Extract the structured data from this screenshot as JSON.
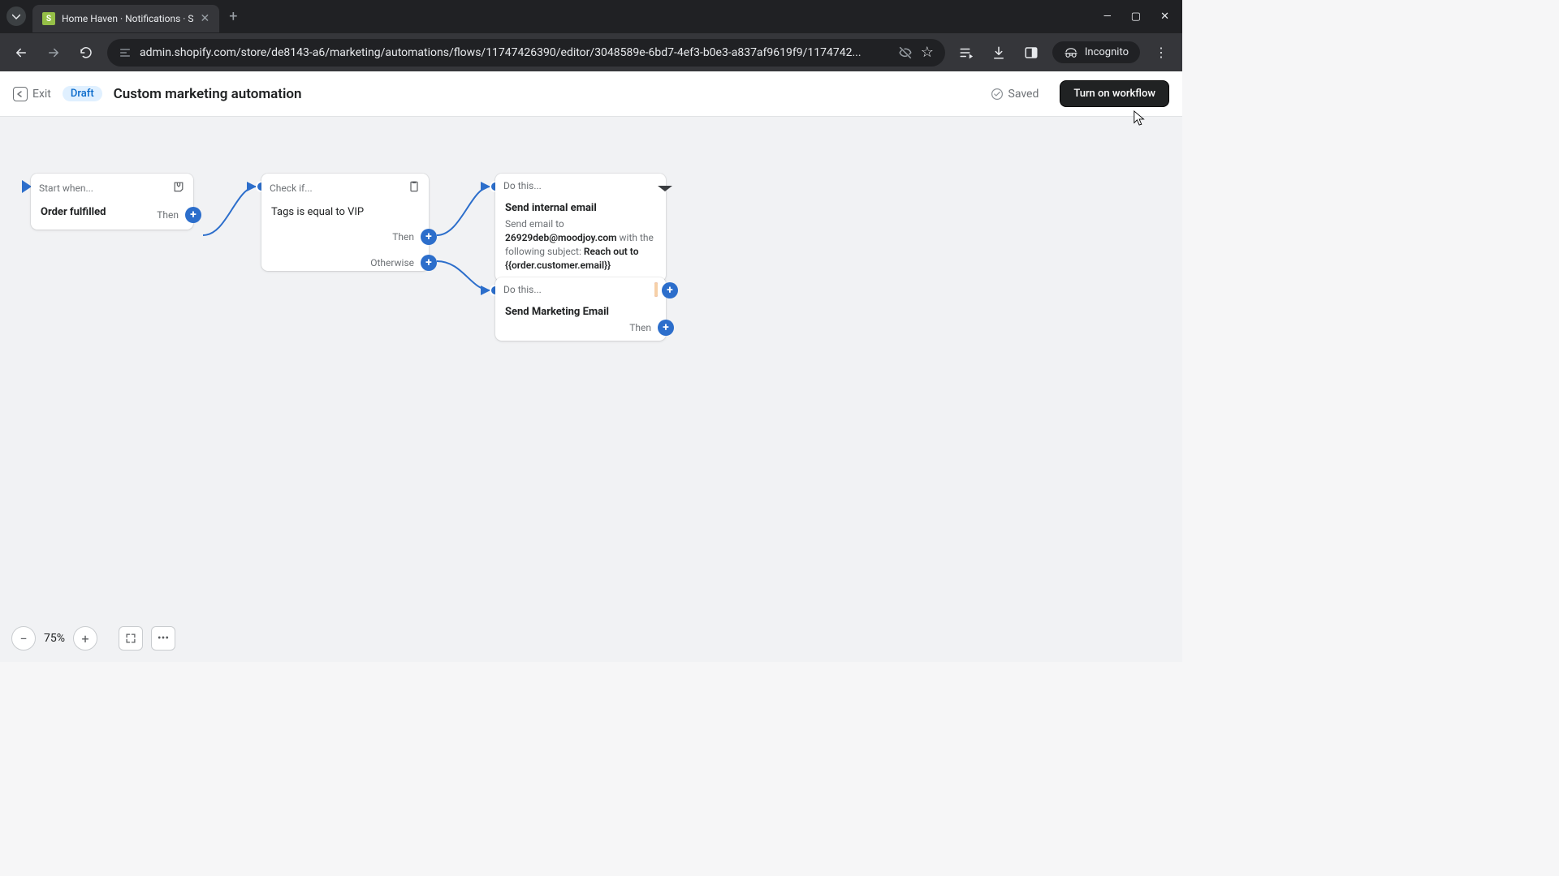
{
  "browser": {
    "tab_title": "Home Haven · Notifications · S",
    "url_display": "admin.shopify.com/store/de8143-a6/marketing/automations/flows/11747426390/editor/3048589e-6bd7-4ef3-b0e3-a837af9619f9/1174742...",
    "incognito_label": "Incognito"
  },
  "header": {
    "exit_label": "Exit",
    "draft_badge": "Draft",
    "title": "Custom marketing automation",
    "saved_label": "Saved",
    "turn_on_label": "Turn on workflow"
  },
  "nodes": {
    "start": {
      "header": "Start when...",
      "body": "Order fulfilled",
      "then": "Then"
    },
    "check": {
      "header": "Check if...",
      "body": "Tags is equal to VIP",
      "then": "Then",
      "otherwise": "Otherwise"
    },
    "do1": {
      "header": "Do this...",
      "title": "Send internal email",
      "line_send_to": "Send email to",
      "email": "26929deb@moodjoy.com",
      "line_with": " with the following subject: ",
      "subject": "Reach out to {{order.customer.email}}"
    },
    "do2": {
      "header": "Do this...",
      "title": "Send Marketing Email",
      "then": "Then"
    }
  },
  "zoom": {
    "value": "75%"
  }
}
